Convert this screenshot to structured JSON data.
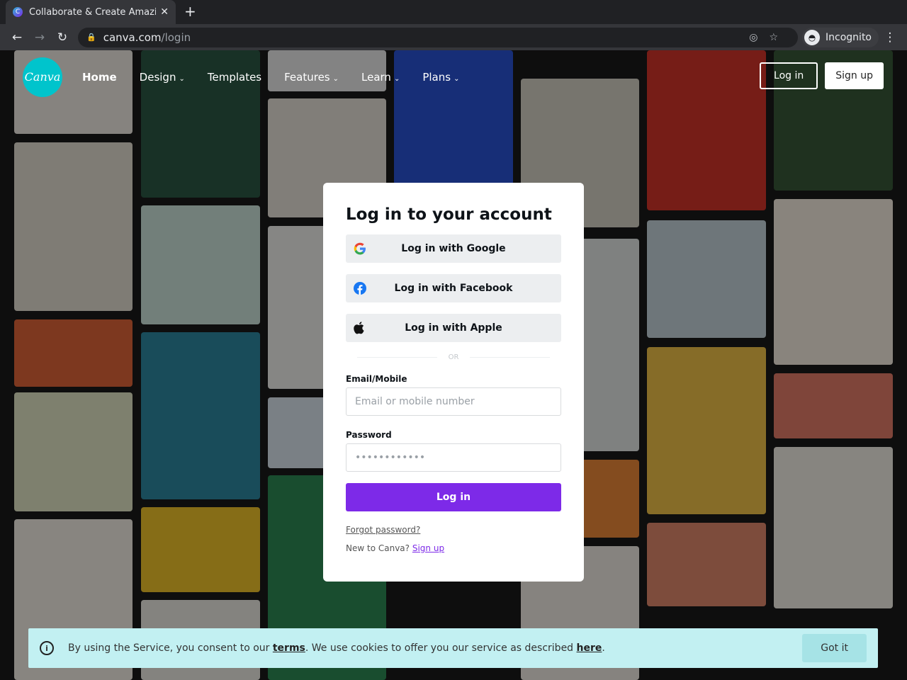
{
  "browser": {
    "tab_title": "Collaborate & Create Amazing",
    "favicon_letter": "C",
    "url_host": "canva.com",
    "url_path": "/login",
    "profile": "Incognito"
  },
  "nav": {
    "logo": "Canva",
    "items": [
      "Home",
      "Design",
      "Templates",
      "Features",
      "Learn",
      "Plans"
    ],
    "login": "Log in",
    "signup": "Sign up"
  },
  "card": {
    "title": "Log in to your account",
    "google": "Log in with Google",
    "facebook": "Log in with Facebook",
    "apple": "Log in with Apple",
    "or": "OR",
    "email_label": "Email/Mobile",
    "email_placeholder": "Email or mobile number",
    "password_label": "Password",
    "password_placeholder": "••••••••••••",
    "login": "Log in",
    "forgot": "Forgot password?",
    "new_to": "New to Canva?",
    "signup": "Sign up"
  },
  "cookie": {
    "pre": "By using the Service, you consent to our ",
    "terms": "terms",
    "mid": ". We use cookies to offer you our service as described ",
    "here": "here",
    "post": ".",
    "button": "Got it"
  },
  "colors": {
    "accent": "#7d2ae8",
    "brand": "#00c4cc"
  }
}
